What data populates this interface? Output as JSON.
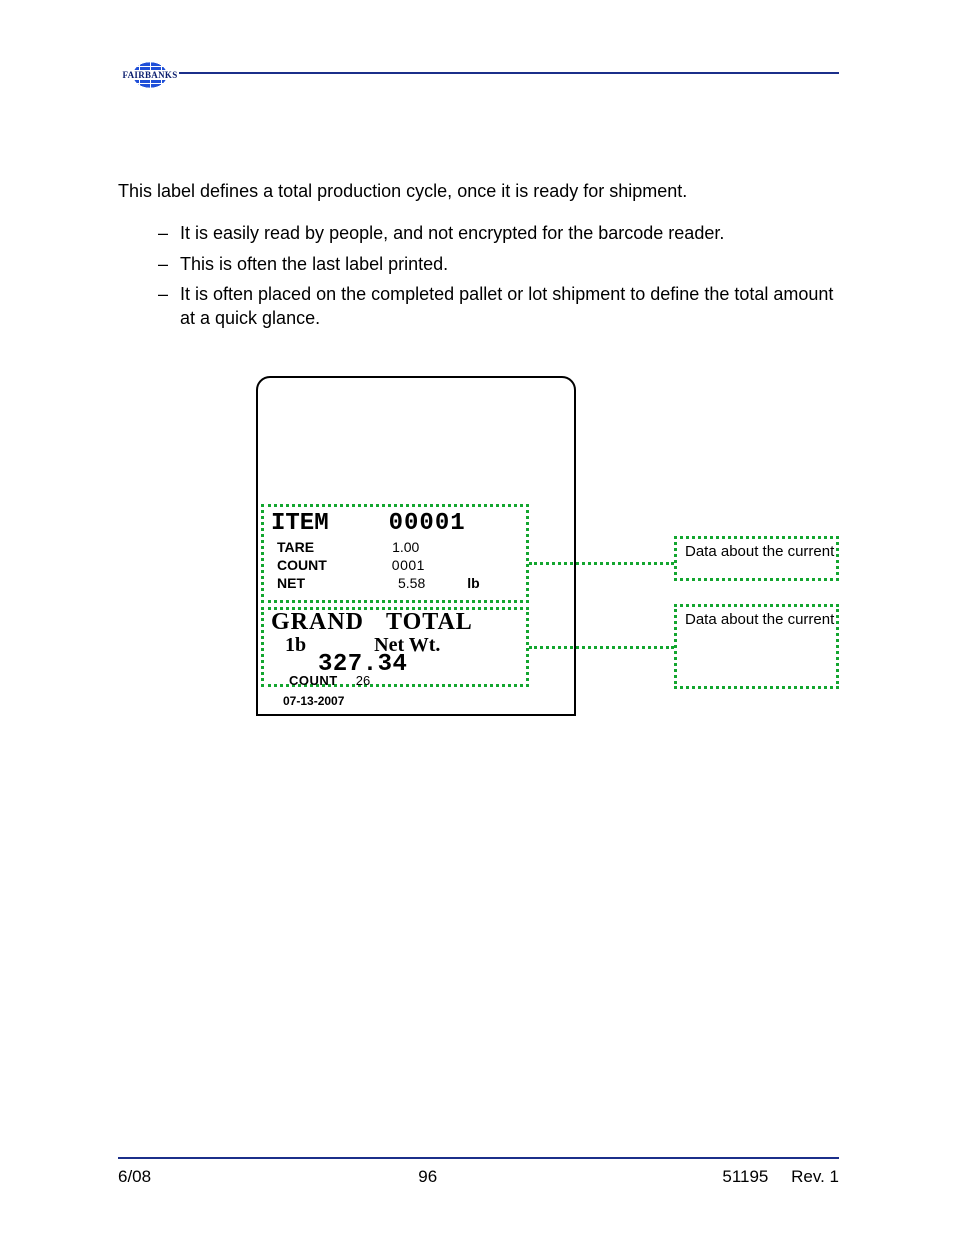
{
  "logo_text": "FAIRBANKS",
  "intro": "This label defines a total production cycle, once it is ready for shipment.",
  "bullets": [
    "It is easily read by people, and not encrypted for the barcode reader.",
    "This is often the last label printed.",
    "It is often placed on the completed pallet or lot shipment to define the total amount at a quick glance."
  ],
  "ticket": {
    "item": {
      "label": "ITEM",
      "value": "00001"
    },
    "tare": {
      "label": "TARE",
      "value": "1.00"
    },
    "count": {
      "label": "COUNT",
      "value": "0001"
    },
    "net": {
      "label": "NET",
      "value": "5.58",
      "unit": "lb"
    },
    "grand": {
      "label": "GRAND",
      "value": "TOTAL"
    },
    "lb_row": {
      "label": "1b",
      "value": "Net Wt."
    },
    "total_value": "327.34",
    "count2": {
      "label": "COUNT",
      "value": "26"
    },
    "date": "07-13-2007"
  },
  "callouts": {
    "c1": "Data about the current",
    "c2": "Data about the current"
  },
  "footer": {
    "left": "6/08",
    "center": "96",
    "docnum": "51195",
    "rev": "Rev. 1"
  }
}
